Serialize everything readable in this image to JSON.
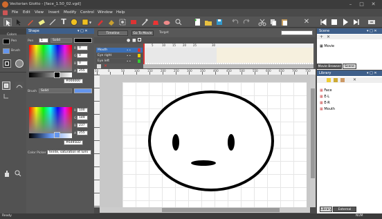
{
  "window": {
    "title": "Vectorian Giotto - [face_1.50_02.vgd]"
  },
  "menu": [
    "File",
    "Edit",
    "View",
    "Insert",
    "Modify",
    "Control",
    "Window",
    "Help"
  ],
  "tools": {
    "label": "Colors",
    "pen": "Pen",
    "brush": "Brush"
  },
  "shape": {
    "title": "Shape",
    "pen_label": "Pen",
    "pen_width": "1",
    "pen_style": "Solid",
    "r": "0",
    "g": "0",
    "b": "0",
    "a": "255",
    "hex": "#000000",
    "brush_label": "Brush",
    "brush_style": "Solid",
    "r2": "100",
    "g2": "149",
    "b2": "237",
    "a2": "255",
    "hex2": "#6495ED",
    "picker_label": "Color Picker",
    "picker_value": "teinte, saturation et lumi"
  },
  "timeline": {
    "tab1": "Timeline",
    "tab2": "Go To Movie",
    "target": "Target",
    "layers": [
      "Mouth",
      "Eye right",
      "Eye left"
    ],
    "frames": [
      "1",
      "5",
      "10",
      "15",
      "20",
      "25",
      "30"
    ]
  },
  "ruler": [
    "50",
    "0",
    "50",
    "100",
    "150",
    "200",
    "250",
    "300",
    "350",
    "400",
    "450",
    "500",
    "550",
    "600",
    "650",
    "700",
    "750"
  ],
  "scene": {
    "title": "Scene",
    "item": "Movie",
    "tab1": "Movie Browser",
    "tab2": "Scene"
  },
  "library": {
    "title": "Library",
    "items": [
      "Face",
      "E-L",
      "E-R",
      "Mouth"
    ],
    "tab1": "Library",
    "tab2": "External Library"
  },
  "status": {
    "left": "Ready",
    "right": "NUM"
  }
}
